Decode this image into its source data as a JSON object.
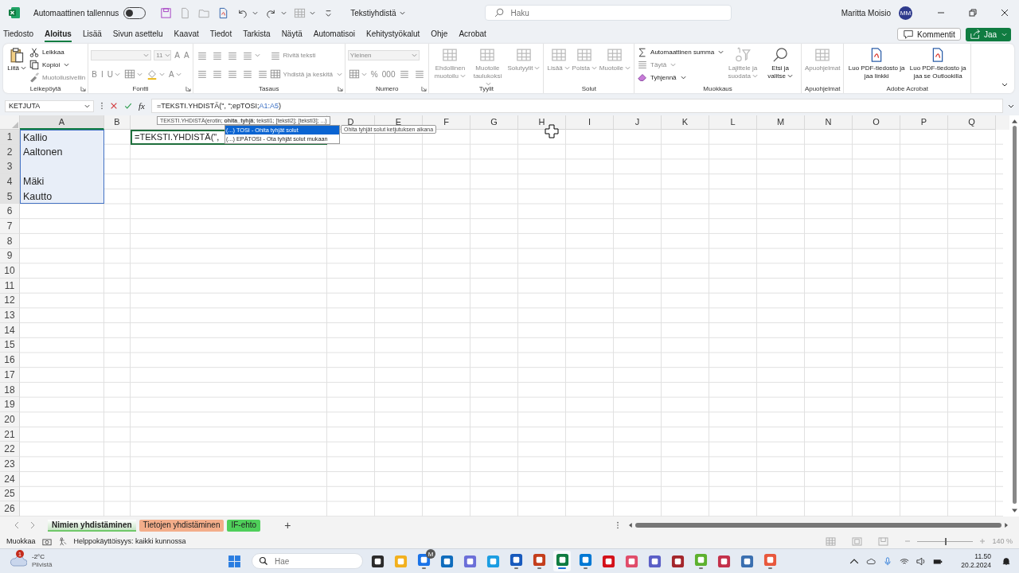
{
  "window": {
    "title": "Tekstiyhdistä",
    "autosave_label": "Automaattinen tallennus",
    "autosave_on": false,
    "search_placeholder": "Haku",
    "user_name": "Maritta Moisio",
    "user_initials": "MM"
  },
  "menu_tabs": [
    {
      "label": "Tiedosto",
      "selected": false
    },
    {
      "label": "Aloitus",
      "selected": true
    },
    {
      "label": "Lisää",
      "selected": false
    },
    {
      "label": "Sivun asettelu",
      "selected": false
    },
    {
      "label": "Kaavat",
      "selected": false
    },
    {
      "label": "Tiedot",
      "selected": false
    },
    {
      "label": "Tarkista",
      "selected": false
    },
    {
      "label": "Näytä",
      "selected": false
    },
    {
      "label": "Automatisoi",
      "selected": false
    },
    {
      "label": "Kehitystyökalut",
      "selected": false
    },
    {
      "label": "Ohje",
      "selected": false
    },
    {
      "label": "Acrobat",
      "selected": false
    }
  ],
  "comments_button": "Kommentit",
  "share_button": "Jaa",
  "ribbon": {
    "groups": [
      {
        "label": "Leikepöytä",
        "launcher": true,
        "columns": [
          [
            [
              {
                "kind": "large",
                "label": "Liitä",
                "caret": true,
                "disabled": false
              }
            ]
          ],
          [
            [
              {
                "kind": "small",
                "label": "Leikkaa",
                "caret": false,
                "disabled": false
              }
            ],
            [
              {
                "kind": "small",
                "label": "Kopioi",
                "caret": true,
                "disabled": false
              }
            ],
            [
              {
                "kind": "small",
                "label": "Muotoilusivellin",
                "caret": false,
                "disabled": true
              }
            ]
          ]
        ]
      },
      {
        "label": "Fontti",
        "launcher": true,
        "columns": [
          [
            [
              {
                "kind": "combo",
                "caret": true,
                "disabled": true
              },
              {
                "kind": "combo",
                "value": "11",
                "caret": true,
                "disabled": true
              },
              {
                "kind": "tool",
                "text": "A",
                "caret": false,
                "disabled": true
              },
              {
                "kind": "tool",
                "text": "A",
                "caret": false,
                "disabled": true
              }
            ],
            [
              {
                "kind": "tool",
                "text": "B",
                "caret": false,
                "disabled": true
              },
              {
                "kind": "tool",
                "text": "I",
                "caret": false,
                "disabled": true
              },
              {
                "kind": "tool",
                "text": "U",
                "caret": true,
                "disabled": true
              },
              {
                "kind": "tool",
                "caret": true,
                "disabled": true
              },
              {
                "kind": "tool",
                "caret": true,
                "disabled": true
              },
              {
                "kind": "tool",
                "text": "A",
                "caret": true,
                "disabled": true
              }
            ]
          ]
        ]
      },
      {
        "label": "Tasaus",
        "launcher": true,
        "columns": [
          [
            [
              {
                "kind": "tool",
                "caret": false,
                "disabled": true
              },
              {
                "kind": "tool",
                "caret": false,
                "disabled": true
              },
              {
                "kind": "tool",
                "caret": false,
                "disabled": true
              },
              {
                "kind": "tool",
                "caret": true,
                "disabled": true
              }
            ],
            [
              {
                "kind": "tool",
                "caret": false,
                "disabled": true
              },
              {
                "kind": "tool",
                "caret": false,
                "disabled": true
              },
              {
                "kind": "tool",
                "caret": false,
                "disabled": true
              },
              {
                "kind": "tool",
                "caret": false,
                "disabled": true
              },
              {
                "kind": "tool",
                "caret": false,
                "disabled": true
              }
            ]
          ],
          [
            [
              {
                "kind": "small",
                "label": "Rivitä teksti",
                "caret": false,
                "disabled": true
              }
            ],
            [
              {
                "kind": "small",
                "label": "Yhdistä ja keskitä",
                "caret": true,
                "disabled": true
              }
            ]
          ]
        ]
      },
      {
        "label": "Numero",
        "launcher": true,
        "columns": [
          [
            [
              {
                "kind": "combo",
                "value": "Yleinen",
                "caret": true,
                "disabled": true
              }
            ],
            [
              {
                "kind": "tool",
                "caret": true,
                "disabled": true
              },
              {
                "kind": "tool",
                "text": "%",
                "caret": false,
                "disabled": true
              },
              {
                "kind": "tool",
                "text": "000",
                "caret": false,
                "disabled": true
              },
              {
                "kind": "tool",
                "caret": false,
                "disabled": true
              },
              {
                "kind": "tool",
                "caret": false,
                "disabled": true
              }
            ]
          ]
        ]
      },
      {
        "label": "Tyylit",
        "launcher": false,
        "columns": [
          [
            [
              {
                "kind": "large",
                "label": "Ehdollinen muotoilu",
                "caret": true,
                "disabled": true
              }
            ]
          ],
          [
            [
              {
                "kind": "large",
                "label": "Muotoile taulukoksi",
                "caret": true,
                "disabled": true
              }
            ]
          ],
          [
            [
              {
                "kind": "large",
                "label": "Solutyylit",
                "caret": true,
                "disabled": true
              }
            ]
          ]
        ]
      },
      {
        "label": "Solut",
        "launcher": false,
        "columns": [
          [
            [
              {
                "kind": "large",
                "label": "Lisää",
                "caret": true,
                "disabled": true
              }
            ]
          ],
          [
            [
              {
                "kind": "large",
                "label": "Poista",
                "caret": true,
                "disabled": true
              }
            ]
          ],
          [
            [
              {
                "kind": "large",
                "label": "Muotoile",
                "caret": true,
                "disabled": true
              }
            ]
          ]
        ]
      },
      {
        "label": "Muokkaus",
        "launcher": false,
        "columns": [
          [
            [
              {
                "kind": "small",
                "label": "Automaattinen summa",
                "caret": true,
                "disabled": false
              }
            ],
            [
              {
                "kind": "small",
                "label": "Täytä",
                "caret": true,
                "disabled": true
              }
            ],
            [
              {
                "kind": "small",
                "label": "Tyhjennä",
                "caret": true,
                "disabled": false
              }
            ]
          ],
          [
            [
              {
                "kind": "large",
                "label": "Lajittele ja suodata",
                "caret": true,
                "disabled": true
              }
            ]
          ],
          [
            [
              {
                "kind": "large",
                "label": "Etsi ja valitse",
                "caret": true,
                "disabled": false
              }
            ]
          ]
        ]
      },
      {
        "label": "Apuohjelmat",
        "launcher": false,
        "columns": [
          [
            [
              {
                "kind": "large",
                "label": "Apuohjelmat",
                "caret": false,
                "disabled": true
              }
            ]
          ]
        ]
      },
      {
        "label": "Adobe Acrobat",
        "launcher": false,
        "columns": [
          [
            [
              {
                "kind": "large",
                "label": "Luo PDF-tiedosto ja jaa linkki",
                "caret": false,
                "disabled": false
              }
            ]
          ],
          [
            [
              {
                "kind": "large",
                "label": "Luo PDF-tiedosto ja jaa se Outlookilla",
                "caret": false,
                "disabled": false
              }
            ]
          ]
        ]
      }
    ]
  },
  "formula_bar": {
    "name_box": "KETJUTA",
    "function_button": "fx",
    "formula": [
      {
        "kind": "text",
        "text": "=TEKSTI.YHDISTÄ(\", \";epTOSI;"
      },
      {
        "kind": "ref",
        "text": "A1:A5"
      },
      {
        "kind": "text",
        "text": ")"
      }
    ]
  },
  "sheet": {
    "columns": [
      {
        "label": "A",
        "selected": true
      },
      {
        "label": "B",
        "selected": false
      },
      {
        "selected": false
      },
      {
        "label": "D",
        "selected": false
      },
      {
        "label": "E",
        "selected": false
      },
      {
        "label": "F",
        "selected": false
      },
      {
        "label": "G",
        "selected": false
      },
      {
        "label": "H",
        "selected": false
      },
      {
        "label": "I",
        "selected": false
      },
      {
        "label": "J",
        "selected": false
      },
      {
        "label": "K",
        "selected": false
      },
      {
        "label": "L",
        "selected": false
      },
      {
        "label": "M",
        "selected": false
      },
      {
        "label": "N",
        "selected": false
      },
      {
        "label": "O",
        "selected": false
      },
      {
        "label": "P",
        "selected": false
      },
      {
        "label": "Q",
        "selected": false
      }
    ],
    "rows": [
      {
        "number": "1",
        "cell_a": "Kallio",
        "selected": true
      },
      {
        "number": "2",
        "cell_a": "Aaltonen",
        "selected": true
      },
      {
        "number": "3",
        "selected": true
      },
      {
        "number": "4",
        "cell_a": "Mäki",
        "selected": true
      },
      {
        "number": "5",
        "cell_a": "Kautto",
        "selected": true
      },
      {
        "number": "6",
        "selected": false
      },
      {
        "number": "7",
        "selected": false
      },
      {
        "number": "8",
        "selected": false
      },
      {
        "number": "9",
        "selected": false
      },
      {
        "number": "10",
        "selected": false
      },
      {
        "number": "11",
        "selected": false
      },
      {
        "number": "12",
        "selected": false
      },
      {
        "number": "13",
        "selected": false
      },
      {
        "number": "14",
        "selected": false
      },
      {
        "number": "15",
        "selected": false
      },
      {
        "number": "16",
        "selected": false
      },
      {
        "number": "17",
        "selected": false
      },
      {
        "number": "18",
        "selected": false
      },
      {
        "number": "19",
        "selected": false
      },
      {
        "number": "20",
        "selected": false
      },
      {
        "number": "21",
        "selected": false
      },
      {
        "number": "22",
        "selected": false
      },
      {
        "number": "23",
        "selected": false
      },
      {
        "number": "24",
        "selected": false
      },
      {
        "number": "25",
        "selected": false
      },
      {
        "number": "26",
        "selected": false
      }
    ],
    "editing_cell": "=TEKSTI.YHDISTÄ(\",",
    "function_tooltip": "TEKSTI.YHDISTÄ(erotin; **ohita_tyhjä**; teksti1; [teksti2]; [teksti3]; ...)",
    "autocomplete": [
      {
        "icon_text": "(...)",
        "label": "TOSI - Ohita tyhjät solut",
        "selected": true
      },
      {
        "icon_text": "(...)",
        "label": "EPÄTOSI - Ota tyhjät solut mukaan",
        "selected": false
      }
    ],
    "autocomplete_hint": "Ohita tyhjät solut ketjutuksen aikana"
  },
  "sheet_tabs": [
    {
      "label": "Nimien yhdistäminen",
      "selected": true,
      "color": "#70c86a"
    },
    {
      "label": "Tietojen yhdistäminen",
      "selected": false,
      "color": "#f3ad8a"
    },
    {
      "label": "IF-ehto",
      "selected": false,
      "color": "#4fcf5a"
    }
  ],
  "add_sheet": "+",
  "status_bar": {
    "mode": "Muokkaa",
    "accessibility": "Helppokäyttöisyys: kaikki kunnossa",
    "zoom": {
      "level": 0.5,
      "reading": "140 %"
    }
  },
  "taskbar": {
    "weather": {
      "temperature": "-2°C",
      "condition": "Pilvistä",
      "badge": "1"
    },
    "search_placeholder": "Hae",
    "apps": [
      {
        "color": "#2b2b2b",
        "running": false,
        "selected": false
      },
      {
        "color": "#f2b01e",
        "running": false,
        "selected": false
      },
      {
        "color": "#1a73e8",
        "running": true,
        "selected": false,
        "badge": "M"
      },
      {
        "color": "#0f6cbd",
        "running": false,
        "selected": false
      },
      {
        "color": "#6b6fd8",
        "running": false,
        "selected": false
      },
      {
        "color": "#1b9de2",
        "running": false,
        "selected": false
      },
      {
        "color": "#185abd",
        "running": true,
        "selected": false
      },
      {
        "color": "#c43e1c",
        "running": true,
        "selected": false
      },
      {
        "color": "#107c41",
        "running": true,
        "selected": true
      },
      {
        "color": "#0078d4",
        "running": true,
        "selected": false
      },
      {
        "color": "#d4111a",
        "running": false,
        "selected": false
      },
      {
        "color": "#e04c6a",
        "running": false,
        "selected": false
      },
      {
        "color": "#5b5fc7",
        "running": false,
        "selected": false
      },
      {
        "color": "#a4262c",
        "running": false,
        "selected": false
      },
      {
        "color": "#5db12f",
        "running": true,
        "selected": false
      },
      {
        "color": "#c4314b",
        "running": false,
        "selected": false
      },
      {
        "color": "#3a6fb0",
        "running": false,
        "selected": false
      },
      {
        "color": "#e8583d",
        "running": true,
        "selected": false
      }
    ],
    "time": "11.50",
    "date": "20.2.2024"
  }
}
